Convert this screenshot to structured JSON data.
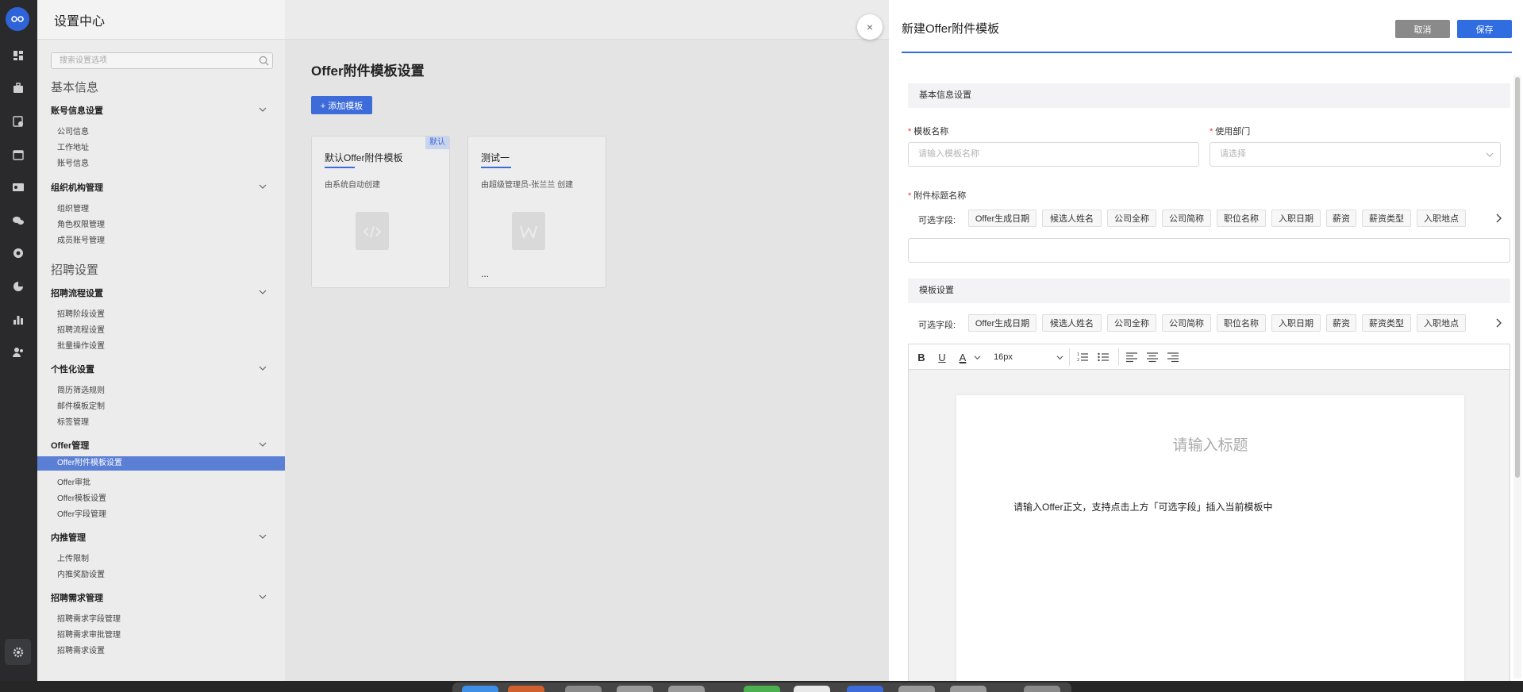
{
  "nav": {
    "title": "设置中心",
    "search_placeholder": "搜索设置选项",
    "section_basic": "基本信息",
    "section_recruit": "招聘设置",
    "groups": [
      {
        "label": "账号信息设置",
        "items": [
          "公司信息",
          "工作地址",
          "账号信息"
        ]
      },
      {
        "label": "组织机构管理",
        "items": [
          "组织管理",
          "角色权限管理",
          "成员账号管理"
        ]
      },
      {
        "label": "招聘流程设置",
        "items": [
          "招聘阶段设置",
          "招聘流程设置",
          "批量操作设置"
        ]
      },
      {
        "label": "个性化设置",
        "items": [
          "简历筛选规则",
          "邮件模板定制",
          "标签管理"
        ]
      },
      {
        "label": "Offer管理",
        "items": [
          "Offer附件模板设置",
          "Offer审批",
          "Offer模板设置",
          "Offer字段管理"
        ]
      },
      {
        "label": "内推管理",
        "items": [
          "上传限制",
          "内推奖励设置"
        ]
      },
      {
        "label": "招聘需求管理",
        "items": [
          "招聘需求字段管理",
          "招聘需求审批管理",
          "招聘需求设置"
        ]
      }
    ]
  },
  "main": {
    "title": "Offer附件模板设置",
    "add_button": "+ 添加模板",
    "cards": [
      {
        "title": "默认Offer附件模板",
        "subtitle": "由系统自动创建",
        "badge": "默认"
      },
      {
        "title": "测试一",
        "subtitle": "由超级管理员-张兰兰 创建",
        "more": "..."
      }
    ]
  },
  "drawer": {
    "title": "新建Offer附件模板",
    "cancel": "取消",
    "save": "保存",
    "close": "×",
    "basic_section": "基本信息设置",
    "name_label": "模板名称",
    "name_placeholder": "请输入模板名称",
    "dept_label": "使用部门",
    "dept_placeholder": "请选择",
    "attach_label": "附件标题名称",
    "fields_label": "可选字段:",
    "fields": [
      "Offer生成日期",
      "候选人姓名",
      "公司全称",
      "公司简称",
      "职位名称",
      "入职日期",
      "薪资",
      "薪资类型",
      "入职地点"
    ],
    "template_section": "模板设置",
    "font_size": "16px",
    "title_placeholder": "请输入标题",
    "body_placeholder": "请输入Offer正文，支持点击上方「可选字段」插入当前模板中"
  },
  "colors": {
    "accent": "#2f6de0",
    "cancel": "#8a8a8a",
    "required": "#e33333"
  }
}
